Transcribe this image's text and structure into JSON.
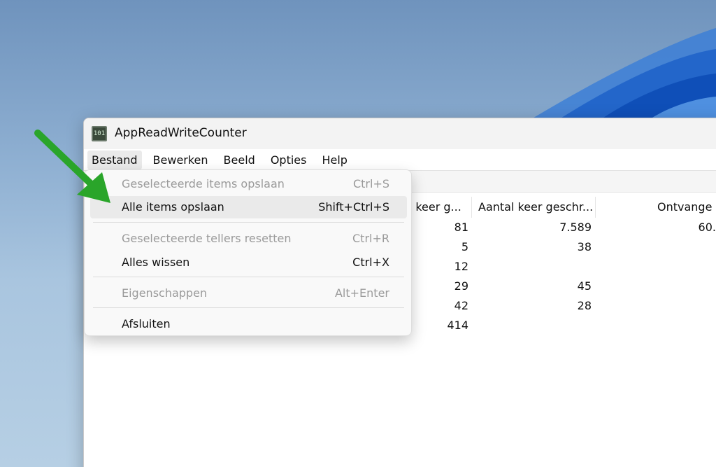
{
  "window": {
    "title": "AppReadWriteCounter",
    "icon_text": "101"
  },
  "menubar": {
    "items": [
      "Bestand",
      "Bewerken",
      "Beeld",
      "Opties",
      "Help"
    ]
  },
  "table": {
    "headers": [
      "al keer g...",
      "Aantal keer geschr...",
      "Ontvange"
    ],
    "rows": [
      [
        "81",
        "7.589",
        "60."
      ],
      [
        "5",
        "38",
        ""
      ],
      [
        "12",
        "",
        ""
      ],
      [
        "29",
        "45",
        ""
      ],
      [
        "42",
        "28",
        ""
      ],
      [
        "414",
        "",
        ""
      ]
    ]
  },
  "file_menu": {
    "items": [
      {
        "label": "Geselecteerde items opslaan",
        "shortcut": "Ctrl+S",
        "enabled": false
      },
      {
        "label": "Alle items opslaan",
        "shortcut": "Shift+Ctrl+S",
        "enabled": true,
        "highlighted": true
      },
      {
        "label": "Geselecteerde tellers resetten",
        "shortcut": "Ctrl+R",
        "enabled": false
      },
      {
        "label": "Alles wissen",
        "shortcut": "Ctrl+X",
        "enabled": true
      },
      {
        "label": "Eigenschappen",
        "shortcut": "Alt+Enter",
        "enabled": false
      },
      {
        "label": "Afsluiten",
        "shortcut": "",
        "enabled": true
      }
    ]
  },
  "colors": {
    "arrow": "#2aa52a",
    "disabled_text": "#9a9a9a",
    "highlight": "#eaeaea"
  }
}
